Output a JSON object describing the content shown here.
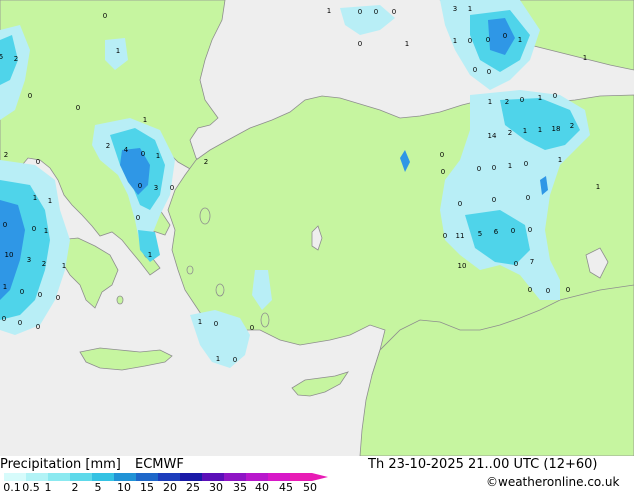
{
  "title": "Precipitation [mm]",
  "model": "ECMWF",
  "valid_time": "Th 23-10-2025 21..00 UTC (12+60)",
  "credit": "©weatheronline.co.uk",
  "colors": {
    "land": "#c6f5a0",
    "sea": "#eeeeee",
    "coast": "#8e8e8e",
    "precip_light": "#b8eef6",
    "precip_mid": "#4fd4ea",
    "precip_heavy": "#2f97e6"
  },
  "legend": {
    "ticks": [
      "0.1",
      "0.5",
      "1",
      "2",
      "5",
      "10",
      "15",
      "20",
      "25",
      "30",
      "35",
      "40",
      "45",
      "50"
    ],
    "colors": [
      "#d6fbfb",
      "#b2f3f6",
      "#8be9f0",
      "#5ed9ea",
      "#34c2e3",
      "#2193d6",
      "#1e67c9",
      "#1d3dbc",
      "#1a1aa7",
      "#5b0fb8",
      "#8f15c5",
      "#b818cc",
      "#d718c8",
      "#e81cb5"
    ]
  },
  "point_values": [
    "0",
    "1",
    "0",
    "0",
    "0",
    "3",
    "1",
    "1",
    "2",
    "5",
    "1",
    "0",
    "0",
    "0",
    "1",
    "0",
    "1",
    "1",
    "0",
    "0",
    "1",
    "2",
    "0",
    "1",
    "0",
    "0",
    "0",
    "1",
    "2",
    "4",
    "0",
    "1",
    "2",
    "14",
    "2",
    "1",
    "1",
    "18",
    "2",
    "2",
    "0",
    "0",
    "1",
    "0",
    "3",
    "0",
    "0",
    "0",
    "1",
    "0",
    "0",
    "1",
    "0",
    "0",
    "1",
    "1",
    "0",
    "0",
    "0",
    "0",
    "1",
    "0",
    "11",
    "5",
    "6",
    "0",
    "0",
    "10",
    "3",
    "2",
    "1",
    "1",
    "10",
    "0",
    "7",
    "1",
    "0",
    "0",
    "0",
    "0",
    "0",
    "0",
    "0",
    "0",
    "0",
    "1",
    "0",
    "0",
    "1",
    "0"
  ]
}
